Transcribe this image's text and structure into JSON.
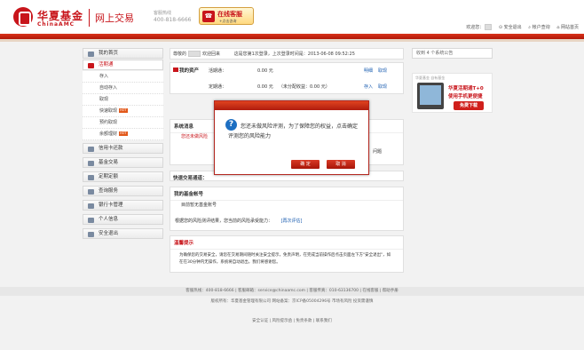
{
  "header": {
    "logo_cn": "华夏基金",
    "logo_en": "ChinaAMC",
    "system_title": "网上交易",
    "hotline_label": "客服热线",
    "hotline_number": "400-818-6666",
    "cs_title": "在线客服",
    "cs_sub": "+点击咨询",
    "welcome": "欢迎您：",
    "exit": "安全退出",
    "account_query": "帐户查询",
    "site_home": "网站首页"
  },
  "sidebar": {
    "items": [
      {
        "label": "我的首页"
      },
      {
        "label": "活期通",
        "active": true,
        "subitems": [
          {
            "label": "存入"
          },
          {
            "label": "自动存入"
          },
          {
            "label": "取现"
          },
          {
            "label": "快速取现",
            "hot": "HOT"
          },
          {
            "label": "预约取现"
          },
          {
            "label": "余额理财",
            "hot": "HOT"
          }
        ]
      },
      {
        "label": "信用卡还款"
      },
      {
        "label": "基金交易"
      },
      {
        "label": "定期定额"
      },
      {
        "label": "查询服务"
      },
      {
        "label": "银行卡管理"
      },
      {
        "label": "个人信息"
      },
      {
        "label": "安全退出"
      }
    ]
  },
  "main": {
    "welcome_prefix": "尊敬的",
    "welcome_suffix": "欢迎回来",
    "last_login": "这是您第1次登录，上次登录时间是：2013-06-08 09:52:25",
    "assets_title": "我的资产",
    "assets_rows": [
      {
        "label": "活期通：",
        "value": "0.00 元",
        "extra": "",
        "links": [
          "明细",
          "取现"
        ]
      },
      {
        "label": "定期通：",
        "value": "0.00 元",
        "extra": "（未分配收益：0.00 元）",
        "links": [
          "存入",
          "取现"
        ]
      }
    ],
    "system_msg_title": "系统消息",
    "system_msg_text": "您还未做风险",
    "system_msg_right": "问题",
    "quick_title": "快速交易通道：",
    "fund_title": "我的基金帐号",
    "fund_empty": "目前暂无基金账号",
    "risk_text": "根据您的风险测评结果，您当前的风险承受能力：",
    "risk_link": "[再次评估]",
    "tips_title": "温馨提示",
    "tips_text": "为确保您的交易安全，请您在交易期间随时关注安全提示，免责声明，在完成当前操作后点击页面左下方\"安全退出\"，如在在30分钟内无操作，系统将自动退出，我们将感谢您。"
  },
  "ad": {
    "tab_label": "收到 4 个系统公告",
    "head": "华夏基金 自有基金",
    "line1": "华夏活期通T+0",
    "line2": "使用手机更便捷",
    "button": "免费下载"
  },
  "footer": {
    "line1": "客服热线：400-818-6666 | 客服邮箱：service@chinaamc.com | 客服传真：010-63136700 | 在线客服 | 帮助手册",
    "line2": "版权所有：华夏基金管理有限公司 网站备案：京ICP备05004296号 市场有风险 投资需谨慎",
    "line3": "安全认证 | 风险提示函 | 免责条款 | 联系我们"
  },
  "modal": {
    "message": "您还未做风险评测，为了保障您的权益，点击确定评测您的风险能力",
    "ok": "确 定",
    "cancel": "取 消"
  }
}
